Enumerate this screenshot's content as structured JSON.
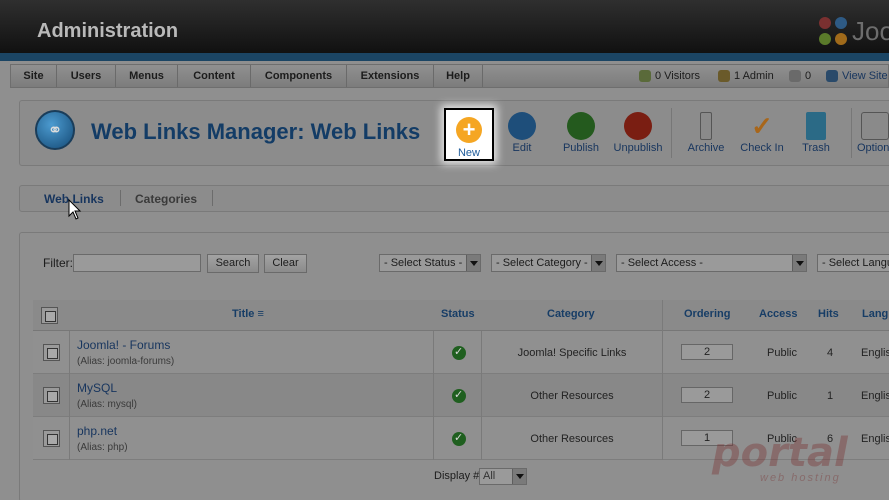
{
  "header": {
    "title": "Administration",
    "logo_text": "Joo"
  },
  "menu": {
    "items": [
      {
        "label": "Site"
      },
      {
        "label": "Users"
      },
      {
        "label": "Menus"
      },
      {
        "label": "Content"
      },
      {
        "label": "Components"
      },
      {
        "label": "Extensions"
      },
      {
        "label": "Help"
      }
    ],
    "status": {
      "visitors": "0 Visitors",
      "admins": "1 Admin",
      "messages": "0",
      "view_site": "View Site"
    }
  },
  "page_title": "Web Links Manager: Web Links",
  "toolbar": {
    "new": "New",
    "edit": "Edit",
    "publish": "Publish",
    "unpublish": "Unpublish",
    "archive": "Archive",
    "checkin": "Check In",
    "trash": "Trash",
    "options": "Options"
  },
  "subtabs": {
    "web_links": "Web Links",
    "categories": "Categories"
  },
  "filter": {
    "label": "Filter:",
    "value": "",
    "search_btn": "Search",
    "clear_btn": "Clear",
    "status_sel": "- Select Status -",
    "category_sel": "- Select Category -",
    "access_sel": "- Select Access -",
    "language_sel": "- Select Langu"
  },
  "table": {
    "headers": {
      "title": "Title",
      "status": "Status",
      "category": "Category",
      "ordering": "Ordering",
      "access": "Access",
      "hits": "Hits",
      "language": "Lang"
    },
    "rows": [
      {
        "title": "Joomla! - Forums",
        "alias": "(Alias: joomla-forums)",
        "category": "Joomla! Specific Links",
        "ordering": "2",
        "access": "Public",
        "hits": "4",
        "language": "Englis"
      },
      {
        "title": "MySQL",
        "alias": "(Alias: mysql)",
        "category": "Other Resources",
        "ordering": "2",
        "access": "Public",
        "hits": "1",
        "language": "Englis"
      },
      {
        "title": "php.net",
        "alias": "(Alias: php)",
        "category": "Other Resources",
        "ordering": "1",
        "access": "Public",
        "hits": "6",
        "language": "Englis"
      }
    ]
  },
  "footer": {
    "display_label": "Display #",
    "display_value": "All"
  },
  "watermark": {
    "text": "portal",
    "sub": "web hosting"
  }
}
